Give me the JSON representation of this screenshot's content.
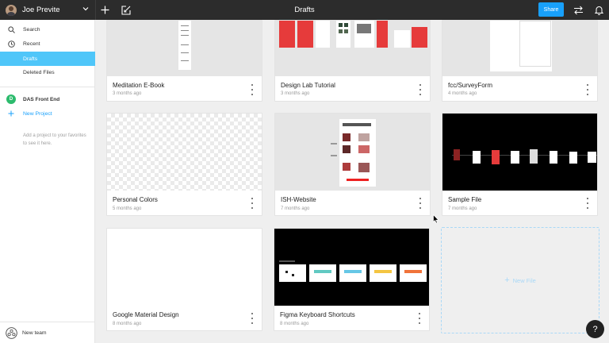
{
  "header": {
    "user_name": "Joe Previte",
    "title": "Drafts",
    "share_label": "Share"
  },
  "sidebar": {
    "items": [
      {
        "label": "Search",
        "icon": "search-icon"
      },
      {
        "label": "Recent",
        "icon": "clock-icon"
      },
      {
        "label": "Drafts",
        "active": true
      },
      {
        "label": "Deleted Files"
      }
    ],
    "team": {
      "badge": "D",
      "name": "DAS Front End"
    },
    "new_project": "New Project",
    "hint": "Add a project to your favorites to see it here.",
    "footer_label": "New team"
  },
  "files": [
    {
      "name": "Meditation E-Book",
      "date": "3 months ago"
    },
    {
      "name": "Design Lab Tutorial",
      "date": "3 months ago"
    },
    {
      "name": "fcc/SurveyForm",
      "date": "4 months ago"
    },
    {
      "name": "Personal Colors",
      "date": "5 months ago"
    },
    {
      "name": "ISH-Website",
      "date": "7 months ago"
    },
    {
      "name": "Sample File",
      "date": "7 months ago"
    },
    {
      "name": "Google Material Design",
      "date": "8 months ago"
    },
    {
      "name": "Figma Keyboard Shortcuts",
      "date": "8 months ago"
    }
  ],
  "new_file_label": "New File",
  "help_label": "?",
  "colors": {
    "topbar": "#2c2c2c",
    "accent": "#18a0fb",
    "active_nav": "#4fc6f9",
    "team_badge": "#2cbb6d"
  }
}
